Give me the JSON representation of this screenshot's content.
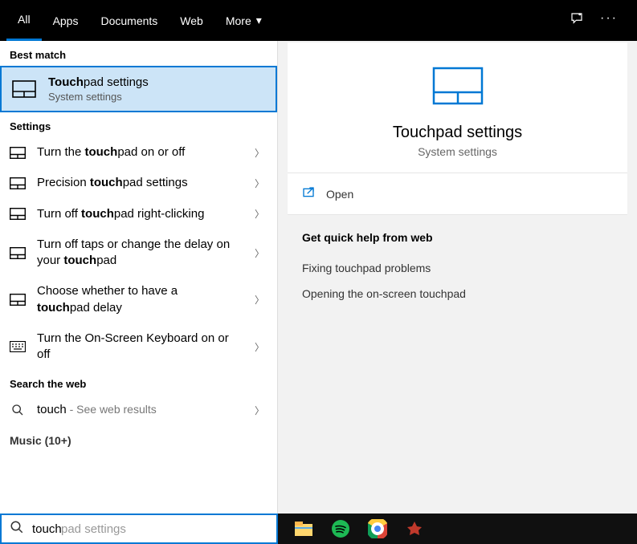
{
  "tabs": {
    "all": "All",
    "apps": "Apps",
    "documents": "Documents",
    "web": "Web",
    "more": "More"
  },
  "sections": {
    "best_match": "Best match",
    "settings": "Settings",
    "search_web": "Search the web",
    "music": "Music (10+)"
  },
  "best_match": {
    "title_bold": "Touch",
    "title_rest": "pad settings",
    "subtitle": "System settings"
  },
  "settings_items": [
    {
      "pre": "Turn the ",
      "bold": "touch",
      "post": "pad on or off",
      "icon": "settings"
    },
    {
      "pre": "Precision ",
      "bold": "touch",
      "post": "pad settings",
      "icon": "settings"
    },
    {
      "pre": "Turn off ",
      "bold": "touch",
      "post": "pad right-clicking",
      "icon": "settings"
    },
    {
      "pre": "Turn off taps or change the delay on your ",
      "bold": "touch",
      "post": "pad",
      "icon": "settings"
    },
    {
      "pre": "Choose whether to have a ",
      "bold": "touch",
      "post": "pad delay",
      "icon": "settings"
    },
    {
      "pre": "Turn the On-Screen Keyboard on or off",
      "bold": "",
      "post": "",
      "icon": "keyboard"
    }
  ],
  "web_search": {
    "query": "touch",
    "suffix": " - See web results"
  },
  "preview": {
    "title": "Touchpad settings",
    "subtitle": "System settings",
    "open": "Open"
  },
  "help": {
    "header": "Get quick help from web",
    "links": [
      "Fixing touchpad problems",
      "Opening the on-screen touchpad"
    ]
  },
  "search": {
    "value": "touch",
    "placeholder": "pad settings"
  }
}
